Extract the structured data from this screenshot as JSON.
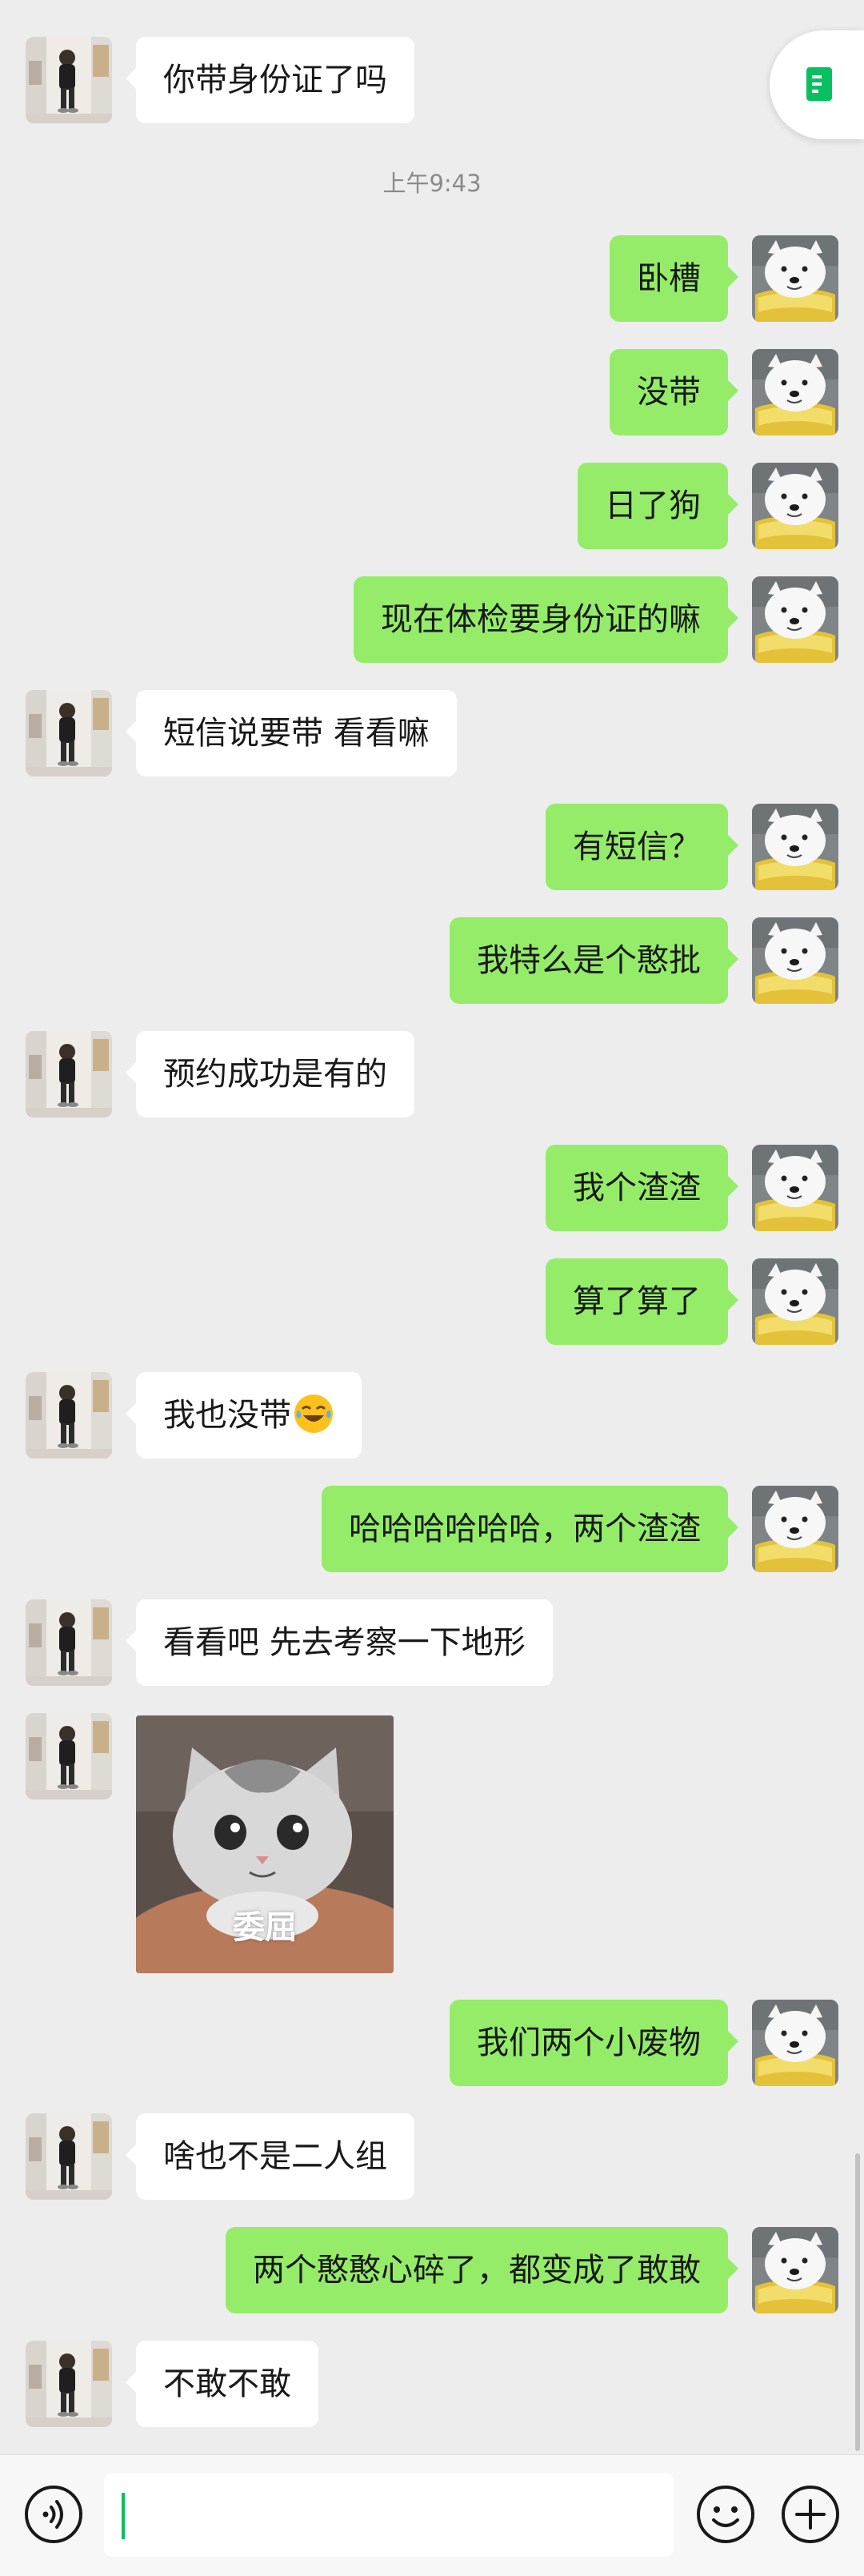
{
  "chat": {
    "timestamp": "上午9:43",
    "messages": [
      {
        "side": "left",
        "text": "你带身份证了吗"
      },
      {
        "side": "right",
        "text": "卧槽"
      },
      {
        "side": "right",
        "text": "没带"
      },
      {
        "side": "right",
        "text": "日了狗"
      },
      {
        "side": "right",
        "text": "现在体检要身份证的嘛"
      },
      {
        "side": "left",
        "text": "短信说要带 看看嘛"
      },
      {
        "side": "right",
        "text": "有短信？"
      },
      {
        "side": "right",
        "text": "我特么是个憨批"
      },
      {
        "side": "left",
        "text": "预约成功是有的"
      },
      {
        "side": "right",
        "text": "我个渣渣"
      },
      {
        "side": "right",
        "text": "算了算了"
      },
      {
        "side": "left",
        "text": "我也没带",
        "emoji": "laughing-crying-emoji"
      },
      {
        "side": "right",
        "text": "哈哈哈哈哈哈，两个渣渣"
      },
      {
        "side": "left",
        "text": "看看吧 先去考察一下地形"
      },
      {
        "side": "left",
        "sticker": "crying-cat-sticker",
        "caption": "委屈"
      },
      {
        "side": "right",
        "text": "我们两个小废物"
      },
      {
        "side": "left",
        "text": "啥也不是二人组"
      },
      {
        "side": "right",
        "text": "两个憨憨心碎了，都变成了敢敢"
      },
      {
        "side": "left",
        "text": "不敢不敢"
      }
    ]
  },
  "floating_button": {
    "icon": "document-icon"
  },
  "input_bar": {
    "voice_icon": "voice-icon",
    "input_value": "",
    "emoji_icon": "emoji-icon",
    "plus_icon": "plus-icon"
  },
  "colors": {
    "background": "#ededed",
    "outgoing_bubble": "#95ec69",
    "incoming_bubble": "#ffffff",
    "accent": "#07c160"
  }
}
